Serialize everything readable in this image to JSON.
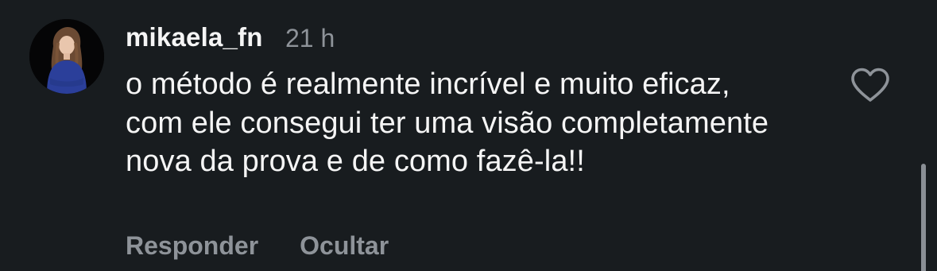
{
  "comment": {
    "username": "mikaela_fn",
    "time": "21 h",
    "text": "o método é realmente incrível e muito eficaz, com ele consegui ter uma visão completamente nova da prova e de como fazê-la!!",
    "actions": {
      "reply": "Responder",
      "hide": "Ocultar"
    },
    "liked": false
  },
  "colors": {
    "background": "#181c1f",
    "primary_text": "#f5f5f5",
    "secondary_text": "#8e9399"
  },
  "icons": {
    "like": "heart-outline-icon",
    "avatar": "profile-photo"
  }
}
